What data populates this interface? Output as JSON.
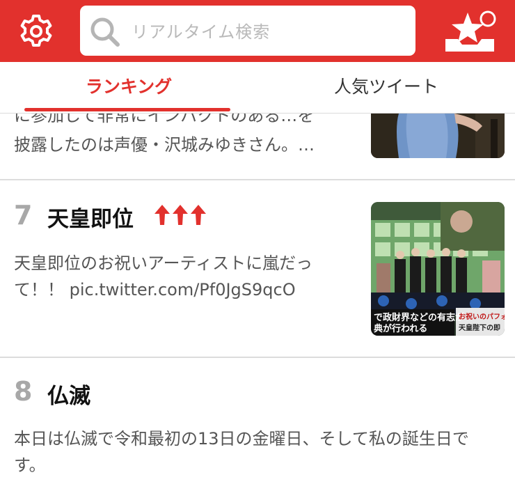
{
  "header": {
    "search_placeholder": "リアルタイム検索",
    "settings_icon": "gear-icon",
    "star_icon": "star-inbox-icon"
  },
  "tabs": [
    {
      "label": "ランキング",
      "active": true
    },
    {
      "label": "人気ツイート",
      "active": false
    }
  ],
  "items": [
    {
      "desc_line1": "に参加して非常にインパクトのある…を",
      "desc_line2": "披露したのは声優・沢城みゆきさん。…"
    },
    {
      "rank": "7",
      "title": "天皇即位",
      "trend_icon": "triple-up-arrow-icon",
      "desc": "天皇即位のお祝いアーティストに嵐だって！！ pic.twitter.com/Pf0JgS9qcO",
      "thumb_caption_1": "で政財界などの有志が",
      "thumb_caption_2": "典が行われる",
      "thumb_caption_3": "お祝いのパフォー",
      "thumb_caption_4": "天皇陛下の即"
    },
    {
      "rank": "8",
      "title": "仏滅",
      "desc": "本日は仏滅で令和最初の13日の金曜日、そして私の誕生日です。"
    }
  ],
  "colors": {
    "brand_red": "#e2312d",
    "rank_gray": "#a8a8a8",
    "divider": "#dcdcdc"
  }
}
